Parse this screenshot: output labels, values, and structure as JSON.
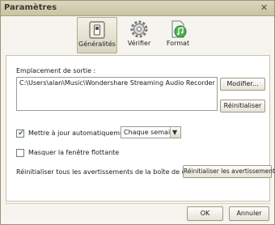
{
  "window": {
    "title": "Paramètres",
    "close_symbol": "✕"
  },
  "toolbar": {
    "tabs": [
      {
        "label": "Généralités",
        "icon": "general-settings-icon",
        "active": true
      },
      {
        "label": "Vérifier",
        "icon": "gear-check-icon",
        "active": false
      },
      {
        "label": "Format",
        "icon": "music-file-icon",
        "active": false
      }
    ]
  },
  "output": {
    "label": "Emplacement de sortie :",
    "path": "C:\\Users\\alan\\Music\\Wondershare Streaming Audio Recorder",
    "modify_label": "Modifier...",
    "reset_label": "Réinitialiser"
  },
  "auto_update": {
    "label": "Mettre à jour automatiquement",
    "checked": true,
    "frequency": "Chaque semain"
  },
  "floating": {
    "label": "Masquer la fenêtre flottante",
    "checked": false
  },
  "warnings": {
    "label": "Réinitialiser tous les avertissements de la boîte de dialogue :",
    "button_label": "Réinitialiser les avertissements"
  },
  "footer": {
    "ok_label": "OK",
    "cancel_label": "Annuler"
  },
  "colors": {
    "check_green": "#2e7d2e",
    "title_bar": "#c9c3a2",
    "background": "#f6f4ee"
  }
}
